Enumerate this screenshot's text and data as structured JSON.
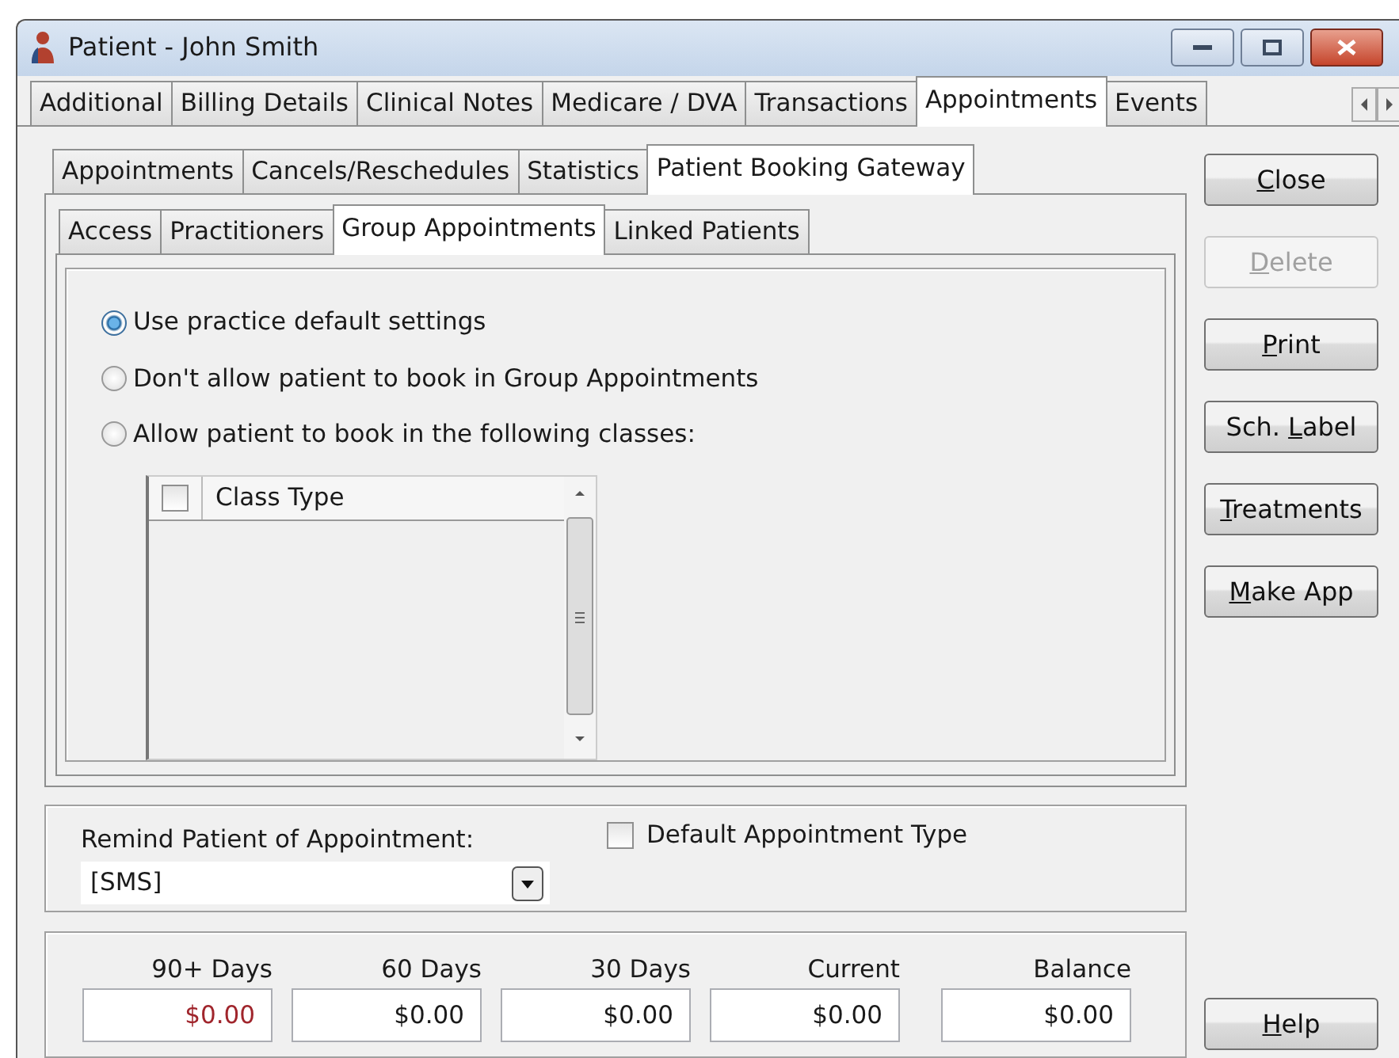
{
  "window": {
    "title": "Patient - John Smith"
  },
  "main_tabs": [
    {
      "label": "Additional",
      "selected": false
    },
    {
      "label": "Billing Details",
      "selected": false
    },
    {
      "label": "Clinical Notes",
      "selected": false
    },
    {
      "label": "Medicare / DVA",
      "selected": false
    },
    {
      "label": "Transactions",
      "selected": false
    },
    {
      "label": "Appointments",
      "selected": true
    },
    {
      "label": "Events",
      "selected": false
    }
  ],
  "sub_tabs": [
    {
      "label": "Appointments",
      "selected": false
    },
    {
      "label": "Cancels/Reschedules",
      "selected": false
    },
    {
      "label": "Statistics",
      "selected": false
    },
    {
      "label": "Patient Booking Gateway",
      "selected": true
    }
  ],
  "gateway_tabs": [
    {
      "label": "Access",
      "selected": false
    },
    {
      "label": "Practitioners",
      "selected": false
    },
    {
      "label": "Group Appointments",
      "selected": true
    },
    {
      "label": "Linked Patients",
      "selected": false
    }
  ],
  "options": [
    {
      "label": "Use practice default settings",
      "selected": true
    },
    {
      "label": "Don't allow patient to book in Group Appointments",
      "selected": false
    },
    {
      "label": "Allow patient to book in the following classes:",
      "selected": false
    }
  ],
  "class_list": {
    "columns": [
      {
        "label": "Class Type",
        "checked": false
      }
    ]
  },
  "reminder": {
    "label": "Remind Patient of Appointment:",
    "value": "[SMS]"
  },
  "default_type": {
    "label": "Default Appointment Type",
    "checked": false
  },
  "aging": [
    {
      "label": "90+ Days",
      "value": "$0.00",
      "overdue": true
    },
    {
      "label": "60 Days",
      "value": "$0.00",
      "overdue": false
    },
    {
      "label": "30 Days",
      "value": "$0.00",
      "overdue": false
    },
    {
      "label": "Current",
      "value": "$0.00",
      "overdue": false
    },
    {
      "label": "Balance",
      "value": "$0.00",
      "overdue": false
    }
  ],
  "buttons": [
    {
      "key": "C",
      "after": "lose",
      "disabled": false
    },
    {
      "key": "D",
      "after": "elete",
      "disabled": true
    },
    {
      "key": "P",
      "after": "rint",
      "disabled": false
    },
    {
      "before": "Sch. ",
      "key": "L",
      "after": "abel",
      "disabled": false
    },
    {
      "key": "T",
      "after": "reatments",
      "disabled": false
    },
    {
      "key": "M",
      "after": "ake App",
      "disabled": false
    }
  ],
  "help_button": {
    "key": "H",
    "after": "elp",
    "disabled": false
  }
}
